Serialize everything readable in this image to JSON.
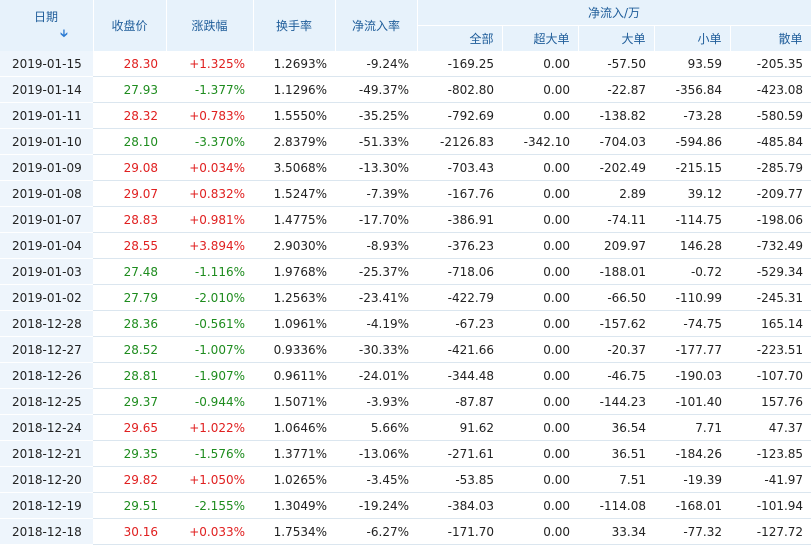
{
  "headers": {
    "date": "日期",
    "close": "收盘价",
    "change": "涨跌幅",
    "turnover": "换手率",
    "net_rate": "净流入率",
    "net_group": "净流入/万",
    "all": "全部",
    "super_large": "超大单",
    "large": "大单",
    "small": "小单",
    "retail": "散单"
  },
  "sort_icon": "arrow-down-icon",
  "colors": {
    "up": "#e02020",
    "down": "#1e8c1e",
    "header_text": "#1f5d9a",
    "header_bg": "#e7f2fb"
  },
  "rows": [
    {
      "date": "2019-01-15",
      "close": "28.30",
      "change": "+1.325%",
      "turnover": "1.2693%",
      "net_rate": "-9.24%",
      "all": "-169.25",
      "super_large": "0.00",
      "large": "-57.50",
      "small": "93.59",
      "retail": "-205.35",
      "dir": "up"
    },
    {
      "date": "2019-01-14",
      "close": "27.93",
      "change": "-1.377%",
      "turnover": "1.1296%",
      "net_rate": "-49.37%",
      "all": "-802.80",
      "super_large": "0.00",
      "large": "-22.87",
      "small": "-356.84",
      "retail": "-423.08",
      "dir": "down"
    },
    {
      "date": "2019-01-11",
      "close": "28.32",
      "change": "+0.783%",
      "turnover": "1.5550%",
      "net_rate": "-35.25%",
      "all": "-792.69",
      "super_large": "0.00",
      "large": "-138.82",
      "small": "-73.28",
      "retail": "-580.59",
      "dir": "up"
    },
    {
      "date": "2019-01-10",
      "close": "28.10",
      "change": "-3.370%",
      "turnover": "2.8379%",
      "net_rate": "-51.33%",
      "all": "-2126.83",
      "super_large": "-342.10",
      "large": "-704.03",
      "small": "-594.86",
      "retail": "-485.84",
      "dir": "down"
    },
    {
      "date": "2019-01-09",
      "close": "29.08",
      "change": "+0.034%",
      "turnover": "3.5068%",
      "net_rate": "-13.30%",
      "all": "-703.43",
      "super_large": "0.00",
      "large": "-202.49",
      "small": "-215.15",
      "retail": "-285.79",
      "dir": "up"
    },
    {
      "date": "2019-01-08",
      "close": "29.07",
      "change": "+0.832%",
      "turnover": "1.5247%",
      "net_rate": "-7.39%",
      "all": "-167.76",
      "super_large": "0.00",
      "large": "2.89",
      "small": "39.12",
      "retail": "-209.77",
      "dir": "up"
    },
    {
      "date": "2019-01-07",
      "close": "28.83",
      "change": "+0.981%",
      "turnover": "1.4775%",
      "net_rate": "-17.70%",
      "all": "-386.91",
      "super_large": "0.00",
      "large": "-74.11",
      "small": "-114.75",
      "retail": "-198.06",
      "dir": "up"
    },
    {
      "date": "2019-01-04",
      "close": "28.55",
      "change": "+3.894%",
      "turnover": "2.9030%",
      "net_rate": "-8.93%",
      "all": "-376.23",
      "super_large": "0.00",
      "large": "209.97",
      "small": "146.28",
      "retail": "-732.49",
      "dir": "up"
    },
    {
      "date": "2019-01-03",
      "close": "27.48",
      "change": "-1.116%",
      "turnover": "1.9768%",
      "net_rate": "-25.37%",
      "all": "-718.06",
      "super_large": "0.00",
      "large": "-188.01",
      "small": "-0.72",
      "retail": "-529.34",
      "dir": "down"
    },
    {
      "date": "2019-01-02",
      "close": "27.79",
      "change": "-2.010%",
      "turnover": "1.2563%",
      "net_rate": "-23.41%",
      "all": "-422.79",
      "super_large": "0.00",
      "large": "-66.50",
      "small": "-110.99",
      "retail": "-245.31",
      "dir": "down"
    },
    {
      "date": "2018-12-28",
      "close": "28.36",
      "change": "-0.561%",
      "turnover": "1.0961%",
      "net_rate": "-4.19%",
      "all": "-67.23",
      "super_large": "0.00",
      "large": "-157.62",
      "small": "-74.75",
      "retail": "165.14",
      "dir": "down"
    },
    {
      "date": "2018-12-27",
      "close": "28.52",
      "change": "-1.007%",
      "turnover": "0.9336%",
      "net_rate": "-30.33%",
      "all": "-421.66",
      "super_large": "0.00",
      "large": "-20.37",
      "small": "-177.77",
      "retail": "-223.51",
      "dir": "down"
    },
    {
      "date": "2018-12-26",
      "close": "28.81",
      "change": "-1.907%",
      "turnover": "0.9611%",
      "net_rate": "-24.01%",
      "all": "-344.48",
      "super_large": "0.00",
      "large": "-46.75",
      "small": "-190.03",
      "retail": "-107.70",
      "dir": "down"
    },
    {
      "date": "2018-12-25",
      "close": "29.37",
      "change": "-0.944%",
      "turnover": "1.5071%",
      "net_rate": "-3.93%",
      "all": "-87.87",
      "super_large": "0.00",
      "large": "-144.23",
      "small": "-101.40",
      "retail": "157.76",
      "dir": "down"
    },
    {
      "date": "2018-12-24",
      "close": "29.65",
      "change": "+1.022%",
      "turnover": "1.0646%",
      "net_rate": "5.66%",
      "all": "91.62",
      "super_large": "0.00",
      "large": "36.54",
      "small": "7.71",
      "retail": "47.37",
      "dir": "up"
    },
    {
      "date": "2018-12-21",
      "close": "29.35",
      "change": "-1.576%",
      "turnover": "1.3771%",
      "net_rate": "-13.06%",
      "all": "-271.61",
      "super_large": "0.00",
      "large": "36.51",
      "small": "-184.26",
      "retail": "-123.85",
      "dir": "down"
    },
    {
      "date": "2018-12-20",
      "close": "29.82",
      "change": "+1.050%",
      "turnover": "1.0265%",
      "net_rate": "-3.45%",
      "all": "-53.85",
      "super_large": "0.00",
      "large": "7.51",
      "small": "-19.39",
      "retail": "-41.97",
      "dir": "up"
    },
    {
      "date": "2018-12-19",
      "close": "29.51",
      "change": "-2.155%",
      "turnover": "1.3049%",
      "net_rate": "-19.24%",
      "all": "-384.03",
      "super_large": "0.00",
      "large": "-114.08",
      "small": "-168.01",
      "retail": "-101.94",
      "dir": "down"
    },
    {
      "date": "2018-12-18",
      "close": "30.16",
      "change": "+0.033%",
      "turnover": "1.7534%",
      "net_rate": "-6.27%",
      "all": "-171.70",
      "super_large": "0.00",
      "large": "33.34",
      "small": "-77.32",
      "retail": "-127.72",
      "dir": "up"
    }
  ]
}
